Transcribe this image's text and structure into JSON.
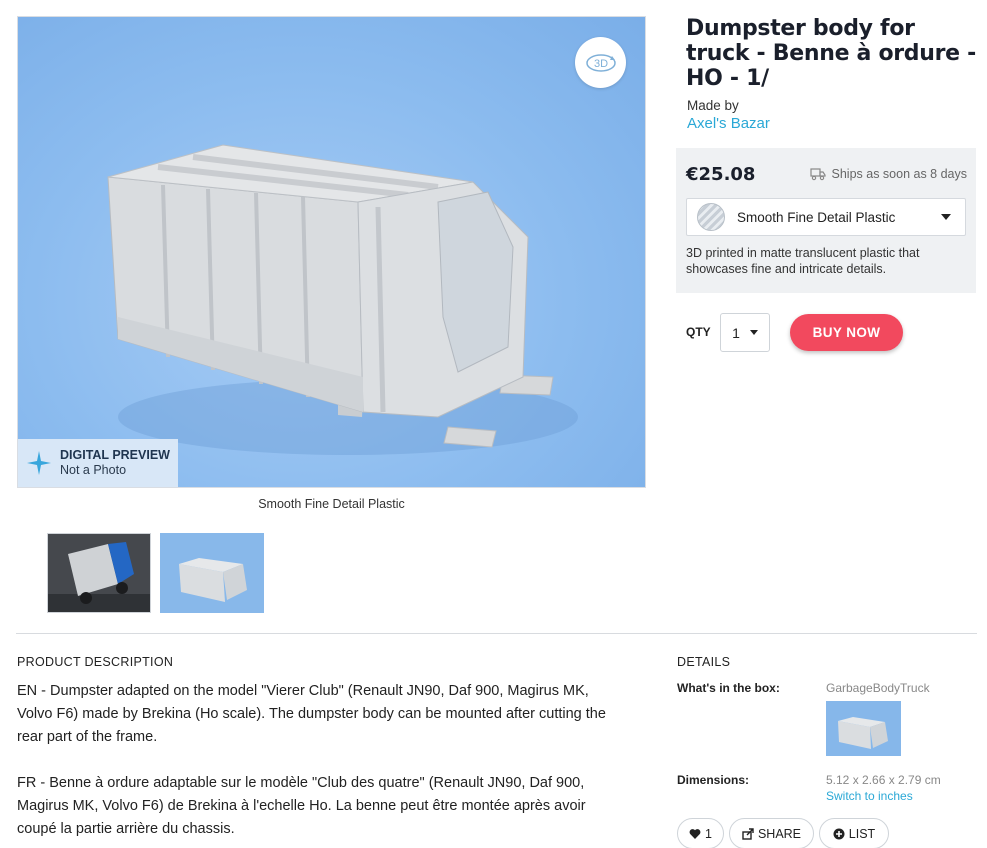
{
  "product": {
    "title": "Dumpster body for truck - Benne à ordure - HO - 1/",
    "made_by_label": "Made by",
    "shop_name": "Axel's Bazar"
  },
  "preview": {
    "badge_title": "DIGITAL PREVIEW",
    "badge_subtitle": "Not a Photo",
    "btn_3d_label": "3D",
    "material_caption": "Smooth Fine Detail Plastic"
  },
  "purchase": {
    "price": "€25.08",
    "ships_text": "Ships as soon as 8 days",
    "material_selected": "Smooth Fine Detail Plastic",
    "material_description": "3D printed in matte translucent plastic that showcases fine and intricate details.",
    "qty_label": "QTY",
    "qty_value": "1",
    "buy_label": "BUY NOW"
  },
  "description": {
    "heading": "PRODUCT DESCRIPTION",
    "paragraphs": [
      "EN - Dumpster adapted on the model \"Vierer Club\" (Renault JN90, Daf 900, Magirus MK, Volvo F6) made by Brekina (Ho scale). The dumpster body can be mounted after cutting the rear part of the frame.",
      "FR - Benne à ordure adaptable sur le modèle \"Club des quatre\" (Renault JN90, Daf 900, Magirus MK, Volvo F6) de Brekina à l'echelle Ho. La benne peut être montée après avoir coupé la partie arrière du chassis."
    ]
  },
  "details": {
    "heading": "DETAILS",
    "box_label": "What's in the box:",
    "box_item": "GarbageBodyTruck",
    "dimensions_label": "Dimensions:",
    "dimensions_value": "5.12 x 2.66 x 2.79 cm",
    "switch_units": "Switch to inches"
  },
  "actions": {
    "like_count": "1",
    "share_label": "SHARE",
    "list_label": "LIST"
  },
  "colors": {
    "accent_link": "#2aa8d6",
    "buy_button": "#f2495e",
    "preview_background": "#8cbcef"
  }
}
